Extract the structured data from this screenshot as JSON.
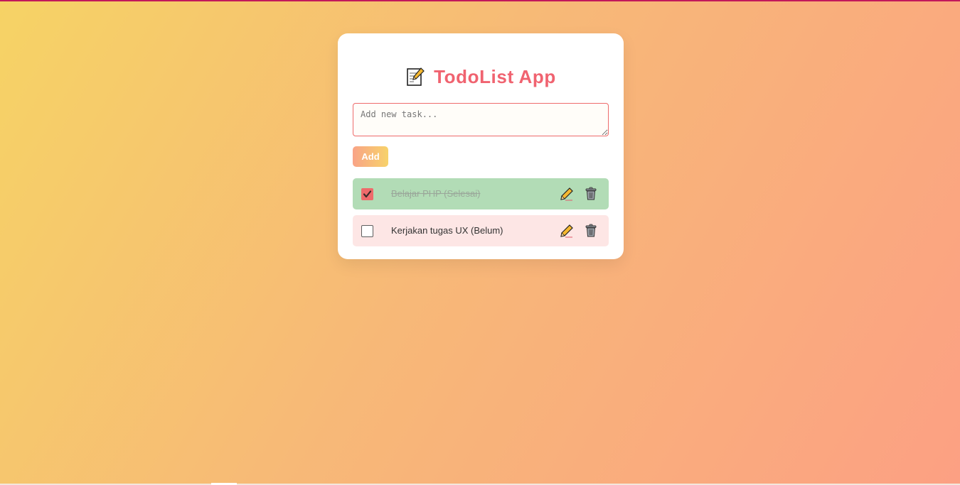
{
  "app": {
    "title": "TodoList App",
    "title_icon": "memo-icon"
  },
  "input": {
    "placeholder": "Add new task...",
    "value": ""
  },
  "actions": {
    "add_label": "Add"
  },
  "todos": [
    {
      "text": "Belajar PHP (Selesai)",
      "completed": true
    },
    {
      "text": "Kerjakan tugas UX (Belum)",
      "completed": false
    }
  ],
  "icons": {
    "edit": "pencil-icon",
    "delete": "trash-icon"
  },
  "colors": {
    "accent": "#f06370",
    "done_bg": "#b2dcb6",
    "pending_bg": "#fde6e5",
    "checkbox_checked": "#ee6b6b"
  }
}
